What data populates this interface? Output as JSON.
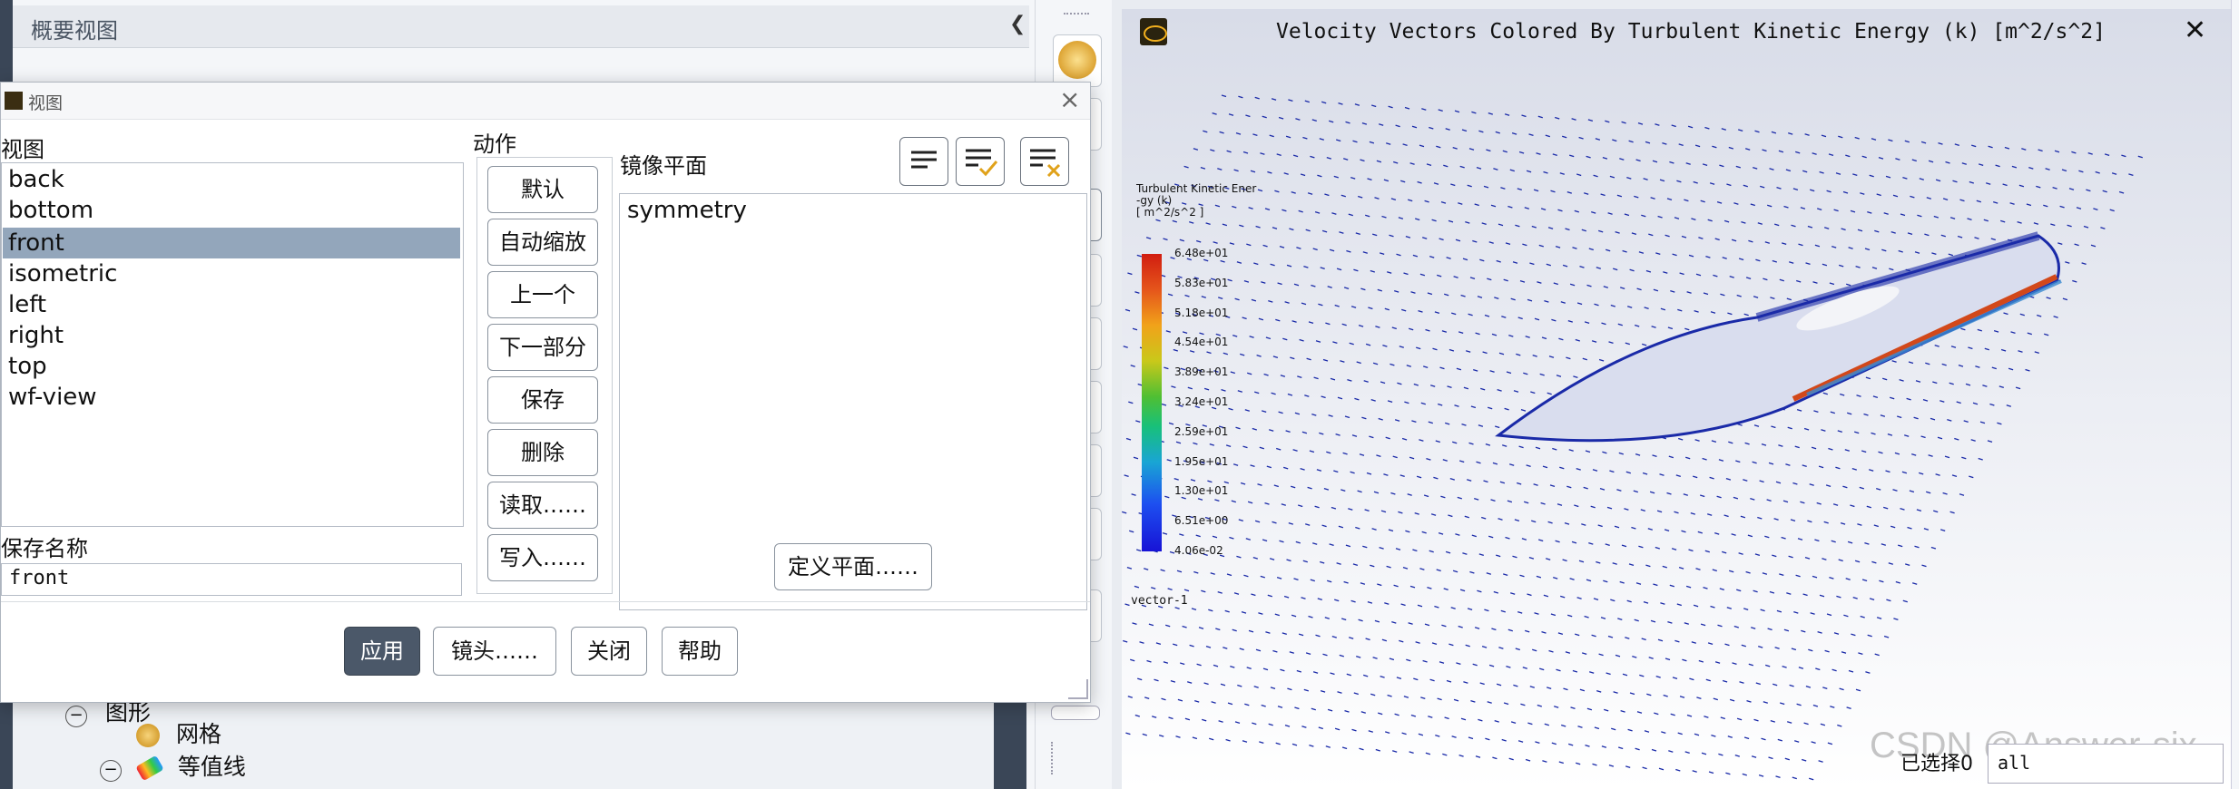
{
  "overview": {
    "title": "概要视图"
  },
  "tree": {
    "item_mesh": "网格",
    "item_contours": "等值线",
    "item_graphics": "图形"
  },
  "graphics": {
    "title": "Velocity Vectors Colored By Turbulent Kinetic Energy (k) [m^2/s^2]",
    "colorbar_title_lines": [
      "Turbulent Kinetic Ener",
      "-gy (k)",
      "[ m^2/s^2 ]"
    ],
    "colorbar_labels": [
      "6.48e+01",
      "5.83e+01",
      "5.18e+01",
      "4.54e+01",
      "3.89e+01",
      "3.24e+01",
      "2.59e+01",
      "1.95e+01",
      "1.30e+01",
      "6.51e+00",
      "4.06e-02"
    ],
    "vector_label": "vector-1",
    "selected_label": "已选择0",
    "selected_value": "all",
    "watermark": "CSDN @Answer-six"
  },
  "dialog": {
    "title": "视图",
    "views_label": "视图",
    "views": [
      "back",
      "bottom",
      "front",
      "isometric",
      "left",
      "right",
      "top",
      "wf-view"
    ],
    "selected_view": "front",
    "actions_label": "动作",
    "actions": [
      "默认",
      "自动缩放",
      "上一个",
      "下一部分",
      "保存",
      "删除",
      "读取……",
      "写入……"
    ],
    "mirror_label": "镜像平面",
    "mirror_planes": [
      "symmetry"
    ],
    "save_name_label": "保存名称",
    "save_name_value": "front",
    "define_plane": "定义平面……",
    "buttons": {
      "apply": "应用",
      "camera": "镜头……",
      "close": "关闭",
      "help": "帮助"
    }
  },
  "colors": {
    "accent": "#4b5869",
    "selection": "#93a6bb",
    "vector": "#1a2aa8"
  }
}
